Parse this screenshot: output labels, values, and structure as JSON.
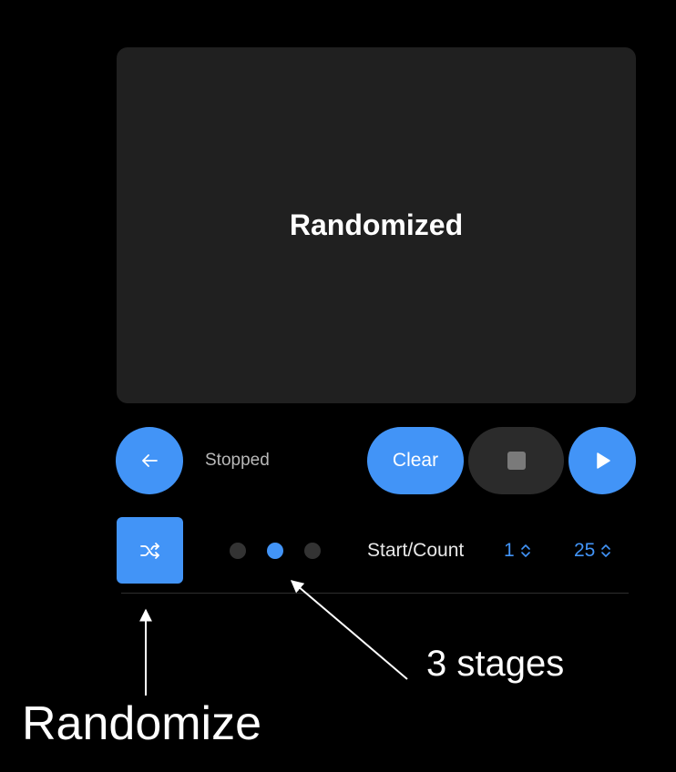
{
  "display": {
    "text": "Randomized"
  },
  "controls": {
    "back_icon": "arrow-left-icon",
    "status": "Stopped",
    "clear_label": "Clear",
    "stop_icon": "stop-icon",
    "play_icon": "play-icon"
  },
  "options": {
    "shuffle_icon": "shuffle-icon",
    "stages": {
      "total": 3,
      "active": 2
    },
    "start_count_label": "Start/Count",
    "start_value": "1",
    "count_value": "25"
  },
  "annotations": {
    "stages_label": "3 stages",
    "randomize_label": "Randomize"
  },
  "colors": {
    "background": "#000000",
    "panel": "#202020",
    "accent": "#4294f7",
    "inactive": "#333333",
    "status_text": "#b8b8b8"
  }
}
